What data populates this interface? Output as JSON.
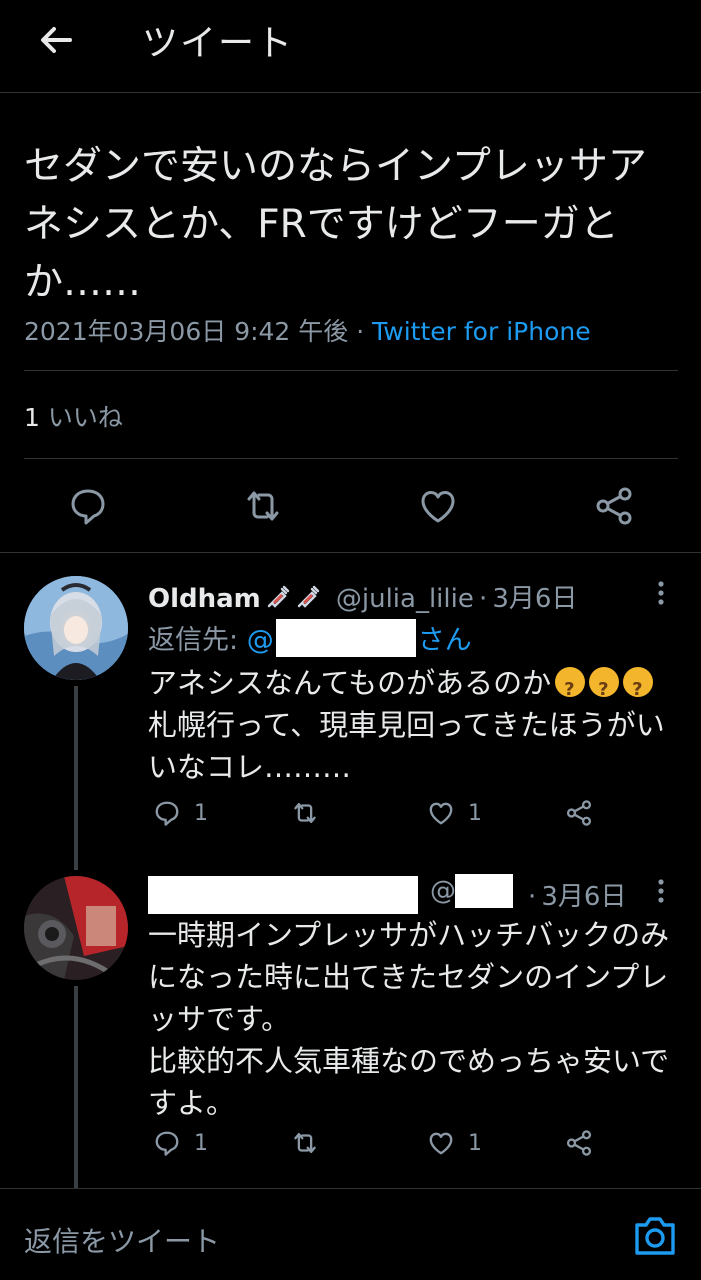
{
  "header": {
    "title": "ツイート"
  },
  "main_tweet": {
    "text": "セダンで安いのならインプレッサアネシスとか、FRですけどフーガとか……",
    "date": "2021年03月06日 9:42 午後",
    "dot": "·",
    "source": "Twitter for iPhone",
    "likes_count": "1",
    "likes_label": "いいね"
  },
  "replies": [
    {
      "name": "Oldham",
      "handle": "@julia_lilie",
      "dot": "·",
      "date": "3月6日",
      "reply_to_label": "返信先:",
      "reply_to_at": "@",
      "reply_to_suffix": "さん",
      "text_line1": "アネシスなんてものがあるのか",
      "text_rest": "札幌行って、現車見回ってきたほうがいいなコレ………",
      "reply_count": "1",
      "like_count": "1"
    },
    {
      "handle_at": "@",
      "dot": "·",
      "date": "3月6日",
      "text": "一時期インプレッサがハッチバックのみになった時に出てきたセダンのインプレッサです。\n比較的不人気車種なのでめっちゃ安いですよ。",
      "reply_count": "1",
      "like_count": "1"
    }
  ],
  "reply_bar": {
    "placeholder": "返信をツイート"
  },
  "colors": {
    "accent": "#1d9bf0",
    "background": "#000000",
    "muted": "#8b98a5"
  }
}
